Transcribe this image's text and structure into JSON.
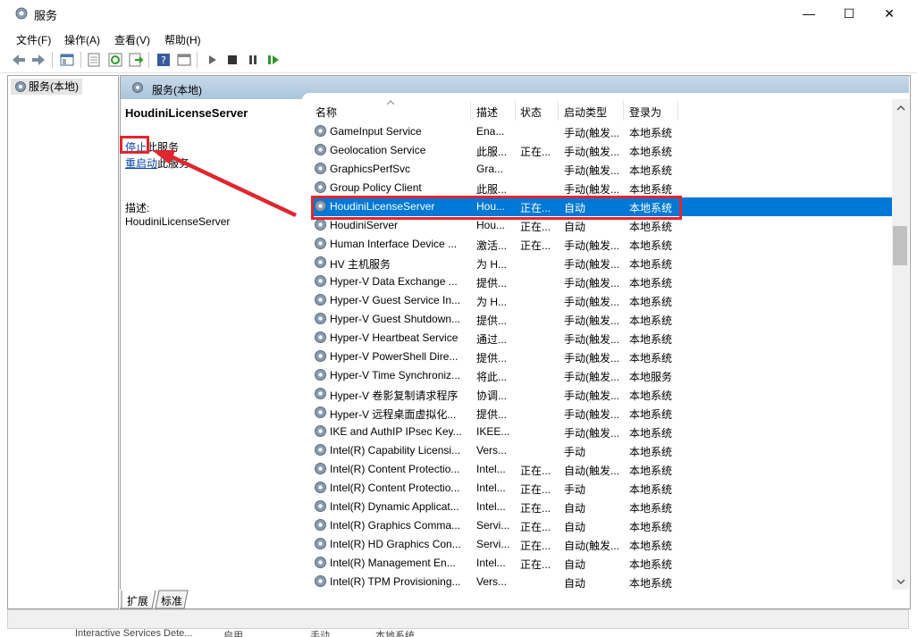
{
  "window": {
    "title": "服务",
    "minimize": "—",
    "maximize": "☐",
    "close": "✕"
  },
  "menu": [
    "文件(F)",
    "操作(A)",
    "查看(V)",
    "帮助(H)"
  ],
  "toolbar_icons": [
    "back-arrow-icon",
    "forward-arrow-icon",
    "console-tree-icon",
    "properties-icon",
    "refresh-icon",
    "export-icon",
    "help-icon",
    "view-icon",
    "play-icon",
    "stop-icon",
    "pause-icon",
    "restart-icon"
  ],
  "tree": {
    "item": "服务(本地)"
  },
  "header": {
    "label": "服务(本地)"
  },
  "detail": {
    "title": "HoudiniLicenseServer",
    "stop_link": "停止",
    "stop_suffix": "此服务",
    "restart_link": "重启动",
    "restart_suffix": "此服务",
    "desc_label": "描述:",
    "desc_value": "HoudiniLicenseServer"
  },
  "columns": [
    "名称",
    "描述",
    "状态",
    "启动类型",
    "登录为"
  ],
  "rows": [
    {
      "name": "GameInput Service",
      "desc": "Ena...",
      "status": "",
      "startup": "手动(触发...",
      "logon": "本地系统"
    },
    {
      "name": "Geolocation Service",
      "desc": "此服...",
      "status": "正在...",
      "startup": "手动(触发...",
      "logon": "本地系统"
    },
    {
      "name": "GraphicsPerfSvc",
      "desc": "Gra...",
      "status": "",
      "startup": "手动(触发...",
      "logon": "本地系统"
    },
    {
      "name": "Group Policy Client",
      "desc": "此服...",
      "status": "",
      "startup": "手动(触发...",
      "logon": "本地系统"
    },
    {
      "name": "HoudiniLicenseServer",
      "desc": "Hou...",
      "status": "正在...",
      "startup": "自动",
      "logon": "本地系统",
      "selected": true
    },
    {
      "name": "HoudiniServer",
      "desc": "Hou...",
      "status": "正在...",
      "startup": "自动",
      "logon": "本地系统"
    },
    {
      "name": "Human Interface Device ...",
      "desc": "激活...",
      "status": "正在...",
      "startup": "手动(触发...",
      "logon": "本地系统"
    },
    {
      "name": "HV 主机服务",
      "desc": "为 H...",
      "status": "",
      "startup": "手动(触发...",
      "logon": "本地系统"
    },
    {
      "name": "Hyper-V Data Exchange ...",
      "desc": "提供...",
      "status": "",
      "startup": "手动(触发...",
      "logon": "本地系统"
    },
    {
      "name": "Hyper-V Guest Service In...",
      "desc": "为 H...",
      "status": "",
      "startup": "手动(触发...",
      "logon": "本地系统"
    },
    {
      "name": "Hyper-V Guest Shutdown...",
      "desc": "提供...",
      "status": "",
      "startup": "手动(触发...",
      "logon": "本地系统"
    },
    {
      "name": "Hyper-V Heartbeat Service",
      "desc": "通过...",
      "status": "",
      "startup": "手动(触发...",
      "logon": "本地系统"
    },
    {
      "name": "Hyper-V PowerShell Dire...",
      "desc": "提供...",
      "status": "",
      "startup": "手动(触发...",
      "logon": "本地系统"
    },
    {
      "name": "Hyper-V Time Synchroniz...",
      "desc": "将此...",
      "status": "",
      "startup": "手动(触发...",
      "logon": "本地服务"
    },
    {
      "name": "Hyper-V 卷影复制请求程序",
      "desc": "协调...",
      "status": "",
      "startup": "手动(触发...",
      "logon": "本地系统"
    },
    {
      "name": "Hyper-V 远程桌面虚拟化...",
      "desc": "提供...",
      "status": "",
      "startup": "手动(触发...",
      "logon": "本地系统"
    },
    {
      "name": "IKE and AuthIP IPsec Key...",
      "desc": "IKEE...",
      "status": "",
      "startup": "手动(触发...",
      "logon": "本地系统"
    },
    {
      "name": "Intel(R) Capability Licensi...",
      "desc": "Vers...",
      "status": "",
      "startup": "手动",
      "logon": "本地系统"
    },
    {
      "name": "Intel(R) Content Protectio...",
      "desc": "Intel...",
      "status": "正在...",
      "startup": "自动(触发...",
      "logon": "本地系统"
    },
    {
      "name": "Intel(R) Content Protectio...",
      "desc": "Intel...",
      "status": "正在...",
      "startup": "手动",
      "logon": "本地系统"
    },
    {
      "name": "Intel(R) Dynamic Applicat...",
      "desc": "Intel...",
      "status": "正在...",
      "startup": "自动",
      "logon": "本地系统"
    },
    {
      "name": "Intel(R) Graphics Comma...",
      "desc": "Servi...",
      "status": "正在...",
      "startup": "自动",
      "logon": "本地系统"
    },
    {
      "name": "Intel(R) HD Graphics Con...",
      "desc": "Servi...",
      "status": "正在...",
      "startup": "自动(触发...",
      "logon": "本地系统"
    },
    {
      "name": "Intel(R) Management En...",
      "desc": "Intel...",
      "status": "正在...",
      "startup": "自动",
      "logon": "本地系统"
    },
    {
      "name": "Intel(R) TPM Provisioning...",
      "desc": "Vers...",
      "status": "",
      "startup": "自动",
      "logon": "本地系统"
    }
  ],
  "tabs": [
    "扩展",
    "标准"
  ],
  "bleed_row": {
    "name": "Interactive Services Dete...",
    "status": "启用",
    "startup": "手动",
    "logon": "本地系统"
  },
  "colors": {
    "selection": "#0078d7",
    "highlight": "#e0262e",
    "header": "#b9cfe3"
  }
}
